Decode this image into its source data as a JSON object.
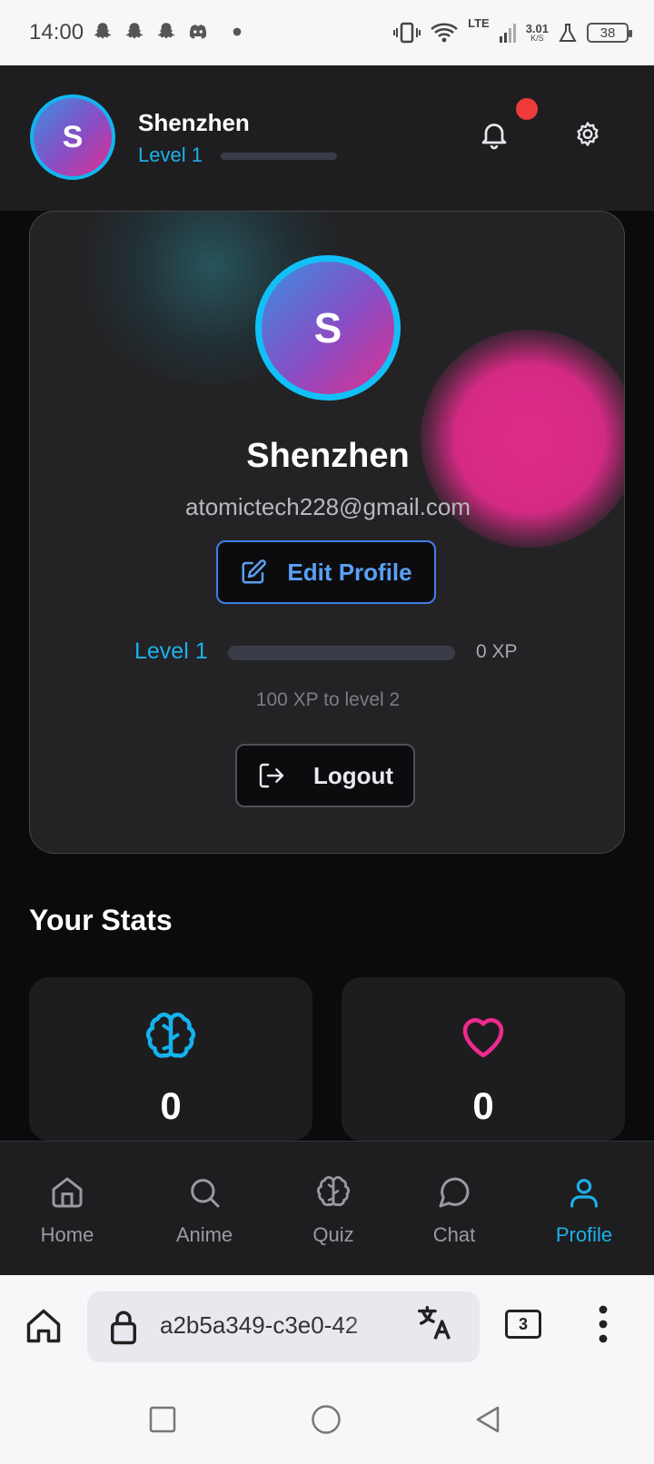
{
  "status_bar": {
    "time": "14:00",
    "network": "LTE",
    "speed": "3.01",
    "speed_unit": "K/S",
    "battery": "38"
  },
  "header": {
    "avatar_initial": "S",
    "username": "Shenzhen",
    "level": "Level 1",
    "level_progress": 0,
    "has_notification": true
  },
  "profile": {
    "avatar_initial": "S",
    "name": "Shenzhen",
    "email": "atomictech228@gmail.com",
    "edit_label": "Edit Profile",
    "level": "Level 1",
    "xp": "0 XP",
    "xp_progress": 0,
    "next_level_text": "100 XP to level 2",
    "logout_label": "Logout"
  },
  "stats": {
    "title": "Your Stats",
    "items": [
      {
        "icon": "brain-icon",
        "value": "0"
      },
      {
        "icon": "heart-icon",
        "value": "0"
      }
    ]
  },
  "nav": {
    "items": [
      {
        "label": "Home",
        "icon": "home-icon"
      },
      {
        "label": "Anime",
        "icon": "search-icon"
      },
      {
        "label": "Quiz",
        "icon": "brain-icon"
      },
      {
        "label": "Chat",
        "icon": "chat-icon"
      },
      {
        "label": "Profile",
        "icon": "user-icon",
        "active": true
      }
    ]
  },
  "browser": {
    "url": "a2b5a349-c3e0-42",
    "tab_count": "3"
  },
  "colors": {
    "accent": "#1eb0ea",
    "pink": "#e0308e",
    "edit_blue": "#5aa0f5",
    "background": "#0b0b0c"
  }
}
